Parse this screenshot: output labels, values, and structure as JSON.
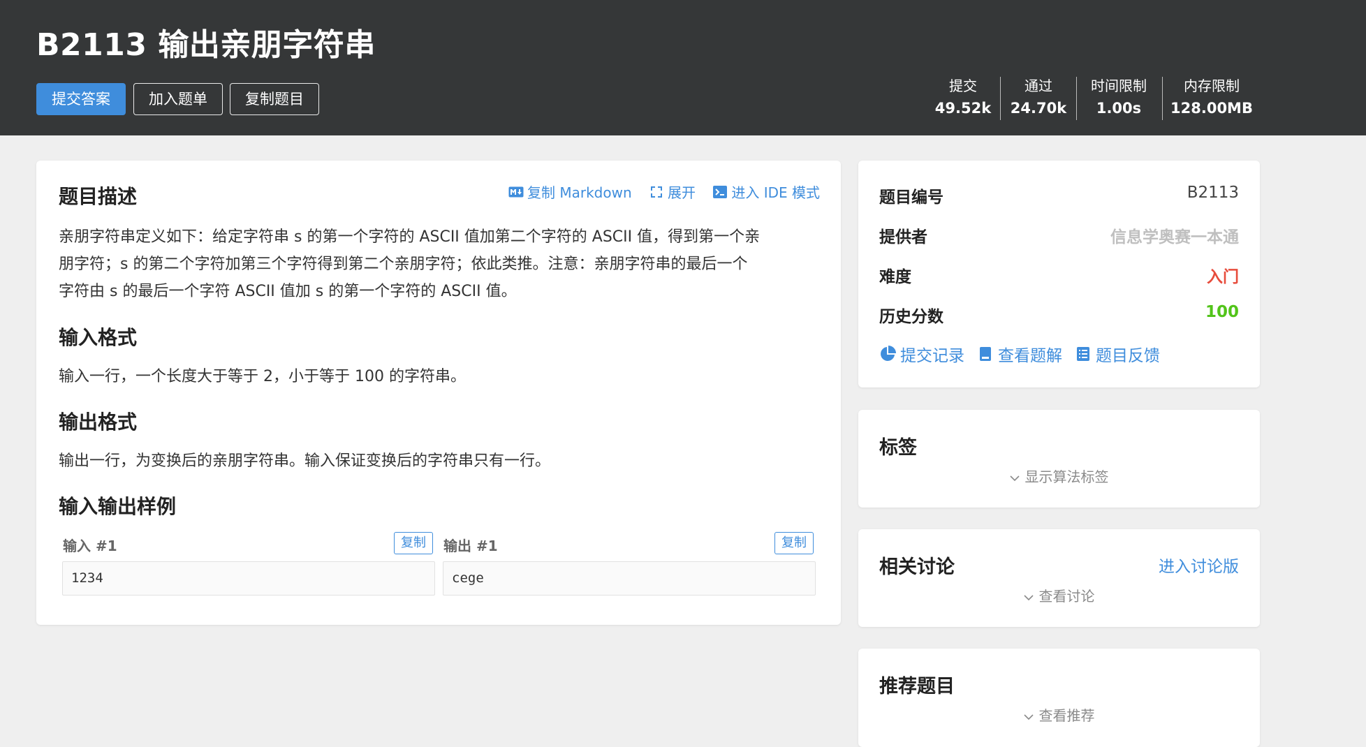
{
  "header": {
    "title": "B2113 输出亲朋字符串",
    "buttons": {
      "submit": "提交答案",
      "add_list": "加入题单",
      "copy_problem": "复制题目"
    },
    "stats": [
      {
        "label": "提交",
        "value": "49.52k"
      },
      {
        "label": "通过",
        "value": "24.70k"
      },
      {
        "label": "时间限制",
        "value": "1.00s"
      },
      {
        "label": "内存限制",
        "value": "128.00MB"
      }
    ]
  },
  "problem": {
    "toolbar": {
      "copy_md": "复制 Markdown",
      "expand": "展开",
      "ide": "进入 IDE 模式"
    },
    "desc_title": "题目描述",
    "desc_lines": [
      "亲朋字符串定义如下：给定字符串 s 的第一个字符的 ASCII 值加第二个字符的 ASCII 值，得到第一个亲",
      "朋字符；s 的第二个字符加第三个字符得到第二个亲朋字符；依此类推。注意：亲朋字符串的最后一个",
      "字符由 s 的最后一个字符 ASCII 值加 s 的第一个字符的 ASCII 值。"
    ],
    "input_title": "输入格式",
    "input_text": "输入一行，一个长度大于等于 2，小于等于 100 的字符串。",
    "output_title": "输出格式",
    "output_text": "输出一行，为变换后的亲朋字符串。输入保证变换后的字符串只有一行。",
    "samples_title": "输入输出样例",
    "sample_input_label": "输入 #1",
    "sample_output_label": "输出 #1",
    "copy_label": "复制",
    "sample_input": "1234",
    "sample_output": "cege"
  },
  "info": {
    "id_label": "题目编号",
    "id_value": "B2113",
    "provider_label": "提供者",
    "provider_value": "信息学奥赛一本通",
    "difficulty_label": "难度",
    "difficulty_value": "入门",
    "score_label": "历史分数",
    "score_value": "100",
    "links": {
      "records": "提交记录",
      "solutions": "查看题解",
      "feedback": "题目反馈"
    }
  },
  "tags": {
    "title": "标签",
    "toggle": "显示算法标签"
  },
  "discuss": {
    "title": "相关讨论",
    "link": "进入讨论版",
    "toggle": "查看讨论"
  },
  "recommend": {
    "title": "推荐题目",
    "toggle": "查看推荐"
  },
  "colors": {
    "accent": "#3f8ddc",
    "header_bg": "#353738",
    "difficulty": "#e74c3c",
    "score": "#52c41a",
    "provider": "#bfbfbf"
  }
}
